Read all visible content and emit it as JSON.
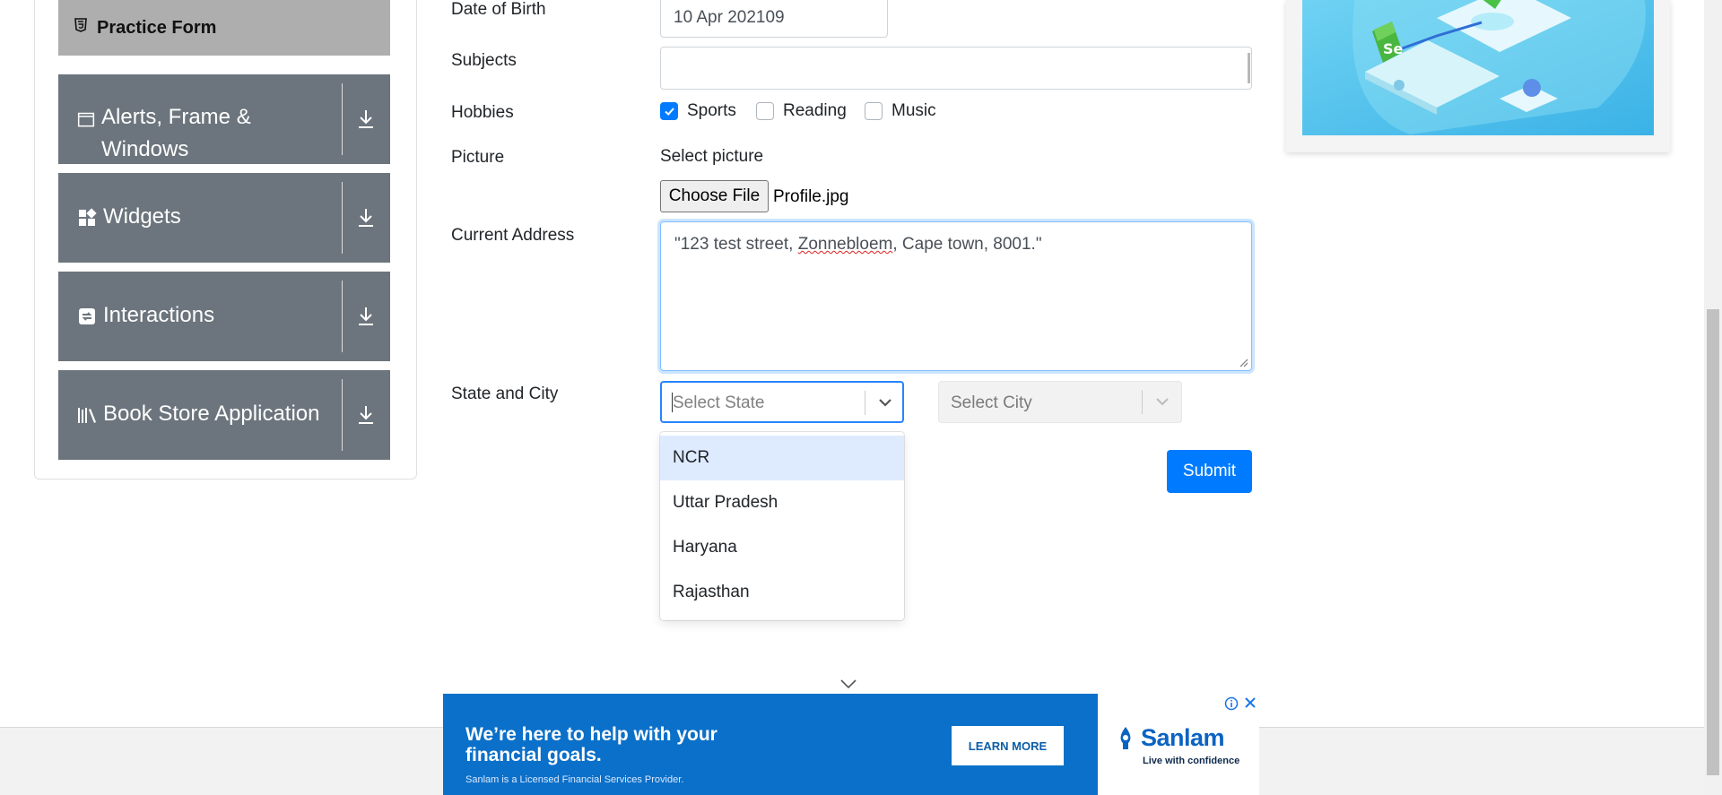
{
  "sidebar": {
    "practice_form": "Practice Form",
    "groups": [
      {
        "line1": "Alerts, Frame &",
        "line2": "Windows"
      },
      {
        "line1": "Widgets"
      },
      {
        "line1": "Interactions"
      },
      {
        "line1": "Book Store Application"
      }
    ]
  },
  "form": {
    "dob": {
      "label": "Date of Birth",
      "value": "10 Apr 202109"
    },
    "subjects": {
      "label": "Subjects",
      "value": ""
    },
    "hobbies": {
      "label": "Hobbies",
      "options": [
        {
          "label": "Sports",
          "checked": true
        },
        {
          "label": "Reading",
          "checked": false
        },
        {
          "label": "Music",
          "checked": false
        }
      ]
    },
    "picture": {
      "label": "Picture",
      "prompt": "Select picture",
      "button": "Choose File",
      "file": "Profile.jpg"
    },
    "address": {
      "label": "Current Address",
      "before": "\"123 test street, ",
      "misspelled": "Zonnebloem",
      "after": ", Cape town, 8001.\""
    },
    "state_city": {
      "label": "State and City",
      "state_placeholder": "Select State",
      "city_placeholder": "Select City",
      "options": [
        "NCR",
        "Uttar Pradesh",
        "Haryana",
        "Rajasthan"
      ]
    },
    "submit": "Submit"
  },
  "ad": {
    "headline": "We’re here to help with your financial goals.",
    "disclaimer": "Sanlam is a Licensed Financial Services Provider.",
    "cta": "LEARN MORE",
    "brand": "Sanlam",
    "tagline": "Live with confidence"
  },
  "colors": {
    "primary": "#007bff",
    "sidebar": "#6c757d",
    "focus": "#2684ff",
    "ad_blue": "#0b70c9"
  }
}
